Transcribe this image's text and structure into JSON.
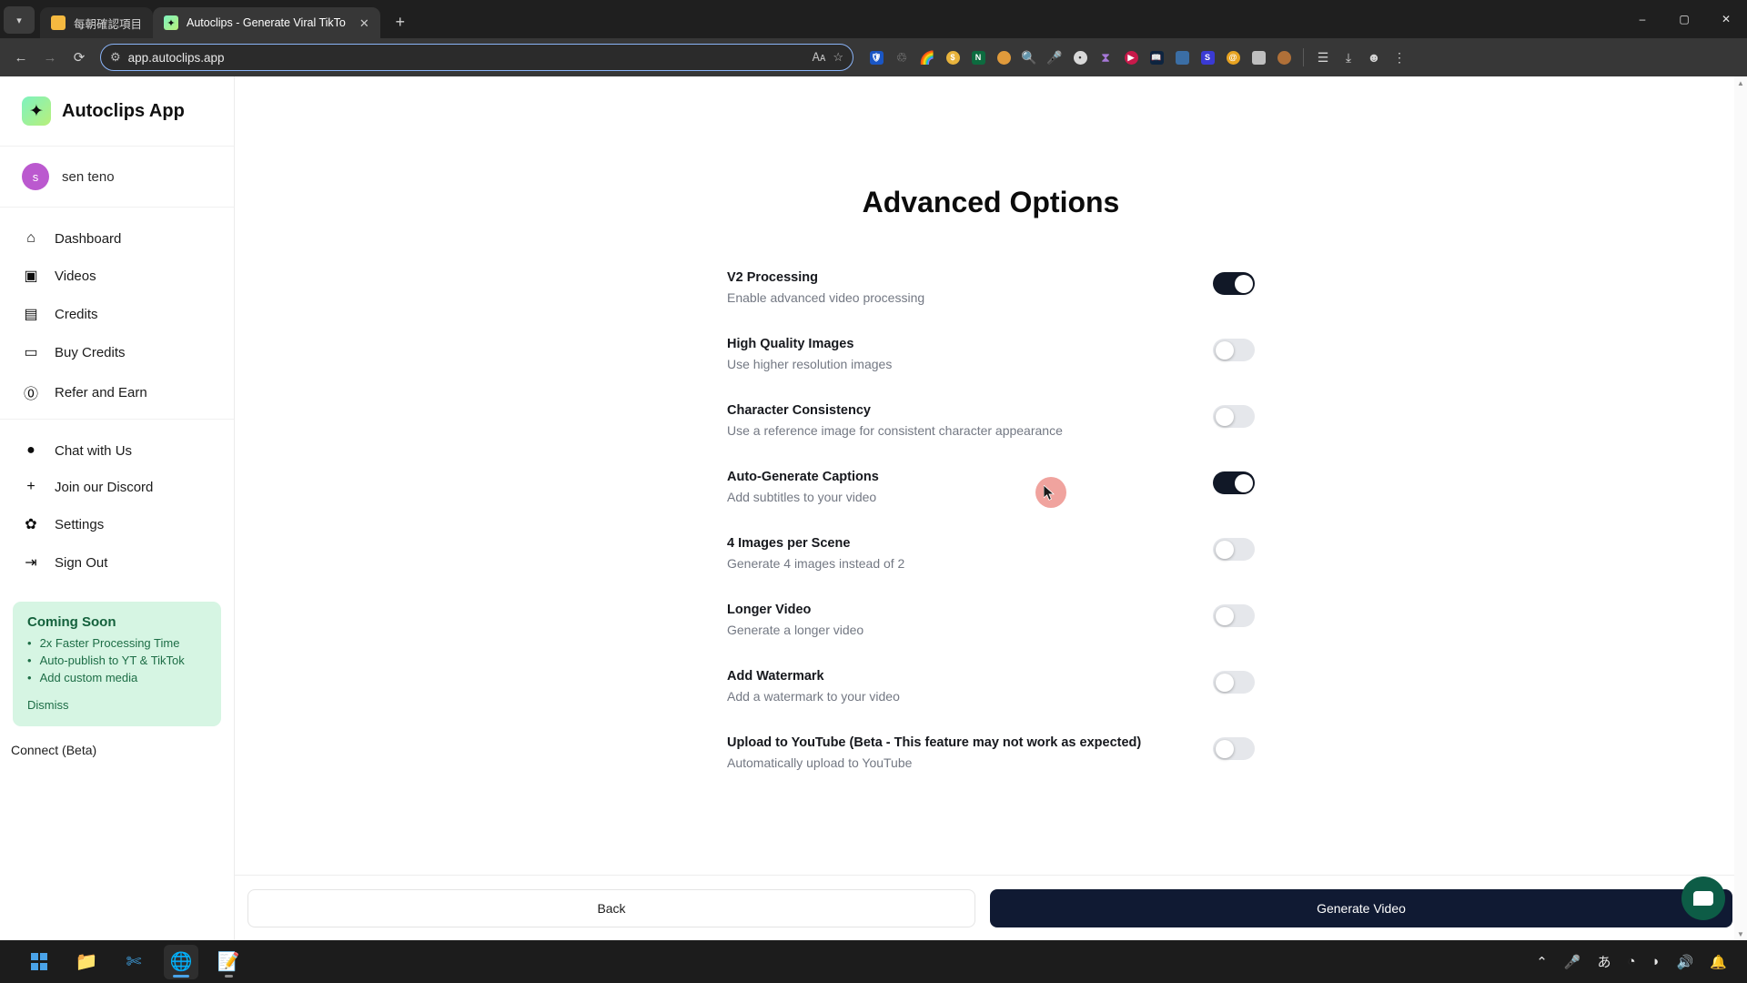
{
  "browser": {
    "tabs": [
      {
        "title": "每朝確認項目",
        "favicon": "folder-icon",
        "active": false
      },
      {
        "title": "Autoclips - Generate Viral TikTo",
        "favicon": "autoclips-icon",
        "active": true
      }
    ],
    "tab_chevron_icon": "chevron-down-icon",
    "new_tab_icon": "plus-icon",
    "window_controls": {
      "minimize": "–",
      "maximize": "▢",
      "close": "✕"
    },
    "nav": {
      "back": "←",
      "forward": "→",
      "reload": "⟳"
    },
    "omnibox": {
      "url": "app.autoclips.app",
      "site_info_icon": "page-info-icon",
      "translate_icon": "translate-icon",
      "bookmark_icon": "star-icon"
    },
    "extensions": [
      "shield-extension-icon",
      "recycle-extension-icon",
      "color-wheel-extension-icon",
      "coin-extension-icon",
      "notion-extension-icon",
      "ninja-extension-icon",
      "search-extension-icon",
      "microphone-extension-icon",
      "robot-extension-icon",
      "hourglass-extension-icon",
      "play-extension-icon",
      "book-extension-icon",
      "blue-extension-icon",
      "s-extension-icon",
      "spiral-extension-icon",
      "frame-extension-icon",
      "cookie-extension-icon"
    ],
    "toolbar_right": [
      "reading-list-icon",
      "download-icon",
      "profile-icon",
      "menu-icon"
    ]
  },
  "sidebar": {
    "brand": {
      "name": "Autoclips App",
      "logo_icon": "sparkle-icon"
    },
    "user": {
      "initial": "s",
      "name": "sen teno"
    },
    "nav_primary": [
      {
        "label": "Dashboard",
        "icon": "home-icon"
      },
      {
        "label": "Videos",
        "icon": "video-camera-icon"
      },
      {
        "label": "Credits",
        "icon": "ticket-icon"
      },
      {
        "label": "Buy Credits",
        "icon": "credit-card-icon"
      },
      {
        "label": "Refer and Earn",
        "icon": "dollar-circle-icon"
      }
    ],
    "nav_secondary": [
      {
        "label": "Chat with Us",
        "icon": "chat-bubble-icon"
      },
      {
        "label": "Join our Discord",
        "icon": "plus-icon"
      },
      {
        "label": "Settings",
        "icon": "gear-icon"
      },
      {
        "label": "Sign Out",
        "icon": "sign-out-icon"
      }
    ],
    "promo": {
      "title": "Coming Soon",
      "items": [
        "2x Faster Processing Time",
        "Auto-publish to YT & TikTok",
        "Add custom media"
      ],
      "dismiss_label": "Dismiss"
    },
    "connect_label": "Connect (Beta)"
  },
  "main": {
    "title": "Advanced Options",
    "options": [
      {
        "label": "V2 Processing",
        "desc": "Enable advanced video processing",
        "enabled": true
      },
      {
        "label": "High Quality Images",
        "desc": "Use higher resolution images",
        "enabled": false
      },
      {
        "label": "Character Consistency",
        "desc": "Use a reference image for consistent character appearance",
        "enabled": false
      },
      {
        "label": "Auto-Generate Captions",
        "desc": "Add subtitles to your video",
        "enabled": true
      },
      {
        "label": "4 Images per Scene",
        "desc": "Generate 4 images instead of 2",
        "enabled": false
      },
      {
        "label": "Longer Video",
        "desc": "Generate a longer video",
        "enabled": false
      },
      {
        "label": "Add Watermark",
        "desc": "Add a watermark to your video",
        "enabled": false
      },
      {
        "label": "Upload to YouTube (Beta - This feature may not work as expected)",
        "desc": "Automatically upload to YouTube",
        "enabled": false
      }
    ],
    "footer": {
      "back_label": "Back",
      "generate_label": "Generate Video"
    },
    "chat_widget_icon": "chat-widget-icon"
  },
  "colors": {
    "accent_dark": "#101a33",
    "promo_bg": "#d6f5e3",
    "promo_text": "#1d6d46",
    "avatar": "#bb59cf",
    "toggle_on": "#111827",
    "toggle_off": "#e5e7eb"
  },
  "taskbar": {
    "apps": [
      {
        "icon": "windows-start-icon",
        "active": false
      },
      {
        "icon": "file-explorer-icon",
        "active": false
      },
      {
        "icon": "vscode-icon",
        "active": false
      },
      {
        "icon": "chrome-icon",
        "active": true
      },
      {
        "icon": "notepad-icon",
        "active": false
      }
    ],
    "tray": [
      "chevron-up-icon",
      "microphone-icon",
      "ime-japanese-icon",
      "moon-icon",
      "wifi-icon",
      "volume-icon",
      "notification-bell-icon"
    ],
    "ime_glyph": "あ"
  }
}
